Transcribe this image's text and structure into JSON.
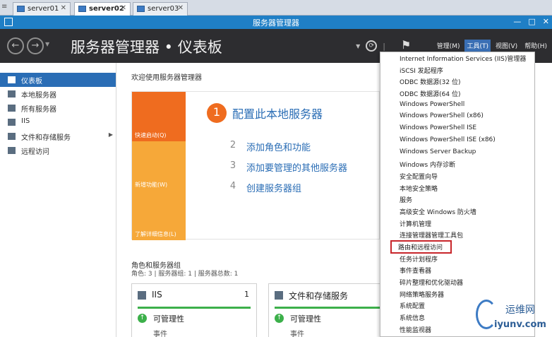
{
  "tabs": [
    {
      "label": "server01",
      "active": false
    },
    {
      "label": "server02",
      "active": true
    },
    {
      "label": "server03",
      "active": false
    }
  ],
  "window": {
    "title": "服务器管理器"
  },
  "header": {
    "breadcrumb": "服务器管理器 • 仪表板",
    "menu": [
      {
        "label": "管理(M)",
        "active": false
      },
      {
        "label": "工具(T)",
        "active": true
      },
      {
        "label": "视图(V)",
        "active": false
      },
      {
        "label": "帮助(H)",
        "active": false
      }
    ]
  },
  "sidebar": {
    "items": [
      {
        "label": "仪表板",
        "icon": "dashboard-icon",
        "active": true
      },
      {
        "label": "本地服务器",
        "icon": "local-server-icon",
        "active": false
      },
      {
        "label": "所有服务器",
        "icon": "all-servers-icon",
        "active": false
      },
      {
        "label": "IIS",
        "icon": "iis-icon",
        "active": false
      },
      {
        "label": "文件和存储服务",
        "icon": "file-storage-icon",
        "active": false,
        "has_submenu": true
      },
      {
        "label": "远程访问",
        "icon": "remote-access-icon",
        "active": false
      }
    ]
  },
  "main": {
    "welcome": "欢迎使用服务器管理器",
    "tiles": [
      "快速启动(Q)",
      "新增功能(W)",
      "了解详细信息(L)"
    ],
    "steps": [
      {
        "num": "1",
        "label": "配置此本地服务器"
      },
      {
        "num": "2",
        "label": "添加角色和功能"
      },
      {
        "num": "3",
        "label": "添加要管理的其他服务器"
      },
      {
        "num": "4",
        "label": "创建服务器组"
      }
    ],
    "roles_title": "角色和服务器组",
    "roles_subtitle": "角色: 3 | 服务器组: 1 | 服务器总数: 1",
    "cards": [
      {
        "title": "IIS",
        "count": "1",
        "status": "可管理性",
        "events": "事件"
      },
      {
        "title": "文件和存储服务",
        "count": "",
        "status": "可管理性",
        "events": "事件"
      }
    ]
  },
  "tools_menu": {
    "items": [
      "Internet Information Services (IIS)管理器",
      "iSCSI 发起程序",
      "ODBC 数据源(32 位)",
      "ODBC 数据源(64 位)",
      "Windows PowerShell",
      "Windows PowerShell (x86)",
      "Windows PowerShell ISE",
      "Windows PowerShell ISE (x86)",
      "Windows Server Backup",
      "Windows 内存诊断",
      "安全配置向导",
      "本地安全策略",
      "服务",
      "高级安全 Windows 防火墙",
      "计算机管理",
      "连接管理器管理工具包",
      "路由和远程访问",
      "任务计划程序",
      "事件查看器",
      "碎片整理和优化驱动器",
      "网络策略服务器",
      "系统配置",
      "系统信息",
      "性能监视器"
    ],
    "highlighted_index": 16,
    "highlight_color": "#c8262b"
  },
  "watermark": {
    "name": "运维网",
    "url": "iyunv.com"
  },
  "colors": {
    "accent": "#2a6db5",
    "quickstart": "#ef6c1f",
    "tile": "#f6a839",
    "header": "#2d2d30",
    "titlebar": "#1f7fc6",
    "ok": "#3cb04a"
  }
}
